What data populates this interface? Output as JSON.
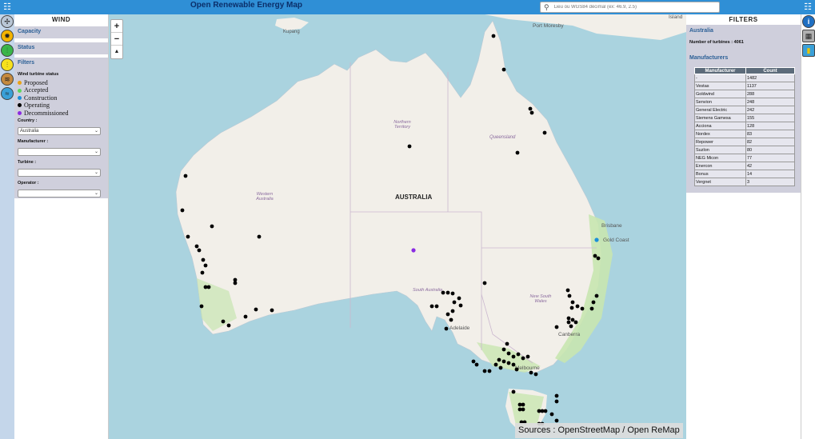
{
  "header": {
    "title": "Open Renewable Energy Map",
    "search_placeholder": "Lieu ou WGS84 décimal (ex: 46.9, 2.5)"
  },
  "left_panel": {
    "title": "WIND",
    "sections": [
      "Capacity",
      "Status"
    ],
    "filters_title": "Filters",
    "status_label": "Wind turbine status",
    "legend": [
      {
        "label": "Proposed",
        "color": "#e8a317"
      },
      {
        "label": "Accepted",
        "color": "#5cd65c"
      },
      {
        "label": "Construction",
        "color": "#1a8fd9"
      },
      {
        "label": "Operating",
        "color": "#000000"
      },
      {
        "label": "Decommissioned",
        "color": "#8a2be2"
      }
    ],
    "country_label": "Country :",
    "country_value": "Australia",
    "manufacturer_label": "Manufacturer :",
    "manufacturer_value": "",
    "turbine_label": "Turbine :",
    "turbine_value": "",
    "operator_label": "Operator :",
    "operator_value": ""
  },
  "right_panel": {
    "title": "FILTERS",
    "country": "Australia",
    "turbines_text": "Number of turbines : 4061",
    "manufacturers_title": "Manufacturers",
    "table_headers": [
      "Manufacturer",
      "Count"
    ],
    "rows": [
      [
        "-",
        "1482"
      ],
      [
        "Vestas",
        "1137"
      ],
      [
        "Goldwind",
        "288"
      ],
      [
        "Senvion",
        "248"
      ],
      [
        "General Electric",
        "242"
      ],
      [
        "Siemens Gamesa",
        "155"
      ],
      [
        "Acciona",
        "128"
      ],
      [
        "Nordex",
        "83"
      ],
      [
        "Repower",
        "82"
      ],
      [
        "Suzlon",
        "80"
      ],
      [
        "NEG Micon",
        "77"
      ],
      [
        "Enercon",
        "42"
      ],
      [
        "Bonus",
        "14"
      ],
      [
        "Vergnet",
        "3"
      ]
    ]
  },
  "map": {
    "country_label": "AUSTRALIA",
    "places": [
      "Kupang",
      "Port Moresby",
      "Island",
      "Northern Territory",
      "Queensland",
      "Western Australia",
      "South Australia",
      "New South Wales",
      "Brisbane",
      "Gold Coast",
      "Adelaide",
      "Canberra",
      "Melbourne"
    ],
    "sources": "Sources : OpenStreetMap / Open ReMap",
    "colors": {
      "sea": "#aad3df",
      "land": "#f2efe9",
      "park": "#c8e6b0"
    }
  }
}
